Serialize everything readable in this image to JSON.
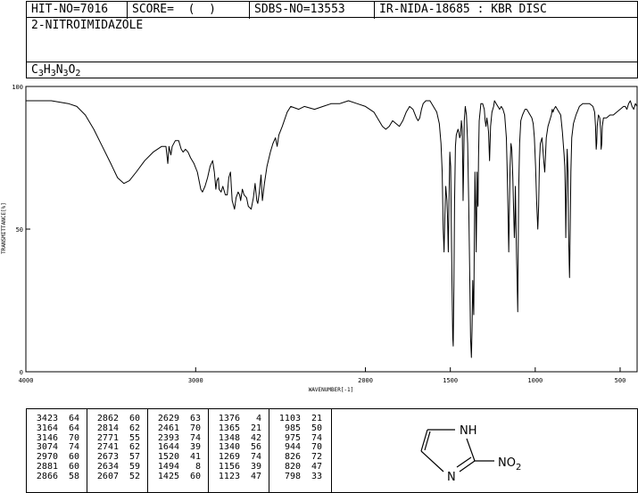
{
  "header": {
    "hit_no": "HIT-NO=7016",
    "score": "SCORE=  (  )",
    "sdbs_no": "SDBS-NO=13553",
    "ir_info": "IR-NIDA-18685 : KBR DISC"
  },
  "compound": {
    "name": "2-NITROIMIDAZOLE",
    "formula_parts": [
      {
        "t": "C",
        "sub": false
      },
      {
        "t": "3",
        "sub": true
      },
      {
        "t": "H",
        "sub": false
      },
      {
        "t": "3",
        "sub": true
      },
      {
        "t": "N",
        "sub": false
      },
      {
        "t": "3",
        "sub": true
      },
      {
        "t": "O",
        "sub": false
      },
      {
        "t": "2",
        "sub": true
      }
    ]
  },
  "chart_data": {
    "type": "line",
    "title": "",
    "xlabel": "WAVENUMBER[-1]",
    "ylabel": "TRANSMITTANCE[%]",
    "xlim": [
      4000,
      400
    ],
    "ylim": [
      0,
      100
    ],
    "x_ticks": [
      4000,
      3000,
      2000,
      1500,
      1000,
      500
    ],
    "y_ticks": [
      0,
      50,
      100
    ],
    "grid": false,
    "series": [
      {
        "points": [
          [
            4000,
            95
          ],
          [
            3850,
            95
          ],
          [
            3750,
            94
          ],
          [
            3700,
            93
          ],
          [
            3650,
            90
          ],
          [
            3600,
            85
          ],
          [
            3550,
            79
          ],
          [
            3500,
            73
          ],
          [
            3460,
            68
          ],
          [
            3423,
            66
          ],
          [
            3390,
            67
          ],
          [
            3350,
            70
          ],
          [
            3300,
            74
          ],
          [
            3250,
            77
          ],
          [
            3200,
            79
          ],
          [
            3175,
            79
          ],
          [
            3164,
            73
          ],
          [
            3157,
            79
          ],
          [
            3146,
            76
          ],
          [
            3138,
            79
          ],
          [
            3120,
            81
          ],
          [
            3100,
            81
          ],
          [
            3085,
            78
          ],
          [
            3074,
            77
          ],
          [
            3060,
            78
          ],
          [
            3045,
            77
          ],
          [
            3030,
            75
          ],
          [
            3010,
            73
          ],
          [
            2990,
            70
          ],
          [
            2980,
            67
          ],
          [
            2970,
            64
          ],
          [
            2960,
            63
          ],
          [
            2945,
            65
          ],
          [
            2930,
            68
          ],
          [
            2915,
            72
          ],
          [
            2900,
            74
          ],
          [
            2890,
            70
          ],
          [
            2881,
            64
          ],
          [
            2875,
            67
          ],
          [
            2866,
            68
          ],
          [
            2862,
            64
          ],
          [
            2850,
            63
          ],
          [
            2840,
            65
          ],
          [
            2825,
            62
          ],
          [
            2814,
            62
          ],
          [
            2805,
            68
          ],
          [
            2795,
            70
          ],
          [
            2785,
            60
          ],
          [
            2771,
            57
          ],
          [
            2762,
            61
          ],
          [
            2750,
            63
          ],
          [
            2741,
            62
          ],
          [
            2735,
            60
          ],
          [
            2725,
            64
          ],
          [
            2715,
            62
          ],
          [
            2700,
            61
          ],
          [
            2690,
            58
          ],
          [
            2673,
            57
          ],
          [
            2660,
            61
          ],
          [
            2650,
            66
          ],
          [
            2640,
            60
          ],
          [
            2634,
            59
          ],
          [
            2625,
            63
          ],
          [
            2615,
            69
          ],
          [
            2607,
            60
          ],
          [
            2595,
            66
          ],
          [
            2580,
            72
          ],
          [
            2560,
            77
          ],
          [
            2545,
            80
          ],
          [
            2530,
            82
          ],
          [
            2520,
            79
          ],
          [
            2510,
            83
          ],
          [
            2490,
            86
          ],
          [
            2461,
            91
          ],
          [
            2440,
            93
          ],
          [
            2393,
            92
          ],
          [
            2360,
            93
          ],
          [
            2300,
            92
          ],
          [
            2250,
            93
          ],
          [
            2200,
            94
          ],
          [
            2150,
            94
          ],
          [
            2100,
            95
          ],
          [
            2050,
            94
          ],
          [
            2000,
            93
          ],
          [
            1950,
            91
          ],
          [
            1920,
            88
          ],
          [
            1900,
            86
          ],
          [
            1880,
            85
          ],
          [
            1860,
            86
          ],
          [
            1840,
            88
          ],
          [
            1820,
            87
          ],
          [
            1800,
            86
          ],
          [
            1780,
            88
          ],
          [
            1760,
            91
          ],
          [
            1740,
            93
          ],
          [
            1720,
            92
          ],
          [
            1700,
            89
          ],
          [
            1690,
            88
          ],
          [
            1680,
            89
          ],
          [
            1670,
            92
          ],
          [
            1660,
            94
          ],
          [
            1644,
            95
          ],
          [
            1620,
            95
          ],
          [
            1600,
            93
          ],
          [
            1580,
            91
          ],
          [
            1565,
            87
          ],
          [
            1555,
            80
          ],
          [
            1548,
            70
          ],
          [
            1542,
            50
          ],
          [
            1537,
            42
          ],
          [
            1532,
            55
          ],
          [
            1527,
            65
          ],
          [
            1520,
            60
          ],
          [
            1517,
            55
          ],
          [
            1512,
            42
          ],
          [
            1508,
            60
          ],
          [
            1503,
            77
          ],
          [
            1498,
            72
          ],
          [
            1494,
            50
          ],
          [
            1490,
            30
          ],
          [
            1486,
            12
          ],
          [
            1483,
            9
          ],
          [
            1479,
            30
          ],
          [
            1475,
            60
          ],
          [
            1470,
            79
          ],
          [
            1465,
            83
          ],
          [
            1460,
            84
          ],
          [
            1455,
            85
          ],
          [
            1450,
            84
          ],
          [
            1445,
            82
          ],
          [
            1440,
            83
          ],
          [
            1435,
            88
          ],
          [
            1430,
            85
          ],
          [
            1427,
            72
          ],
          [
            1425,
            60
          ],
          [
            1422,
            70
          ],
          [
            1418,
            88
          ],
          [
            1412,
            93
          ],
          [
            1405,
            90
          ],
          [
            1398,
            80
          ],
          [
            1392,
            60
          ],
          [
            1386,
            35
          ],
          [
            1381,
            12
          ],
          [
            1376,
            5
          ],
          [
            1372,
            15
          ],
          [
            1368,
            32
          ],
          [
            1365,
            25
          ],
          [
            1362,
            20
          ],
          [
            1359,
            45
          ],
          [
            1355,
            70
          ],
          [
            1350,
            55
          ],
          [
            1348,
            42
          ],
          [
            1345,
            55
          ],
          [
            1343,
            70
          ],
          [
            1340,
            60
          ],
          [
            1337,
            58
          ],
          [
            1334,
            75
          ],
          [
            1330,
            88
          ],
          [
            1320,
            94
          ],
          [
            1310,
            94
          ],
          [
            1300,
            92
          ],
          [
            1295,
            88
          ],
          [
            1290,
            86
          ],
          [
            1285,
            89
          ],
          [
            1280,
            87
          ],
          [
            1275,
            84
          ],
          [
            1269,
            74
          ],
          [
            1263,
            86
          ],
          [
            1255,
            91
          ],
          [
            1245,
            93
          ],
          [
            1240,
            95
          ],
          [
            1230,
            94
          ],
          [
            1220,
            93
          ],
          [
            1210,
            92
          ],
          [
            1200,
            93
          ],
          [
            1190,
            92
          ],
          [
            1180,
            90
          ],
          [
            1170,
            82
          ],
          [
            1165,
            70
          ],
          [
            1160,
            55
          ],
          [
            1156,
            42
          ],
          [
            1152,
            58
          ],
          [
            1148,
            72
          ],
          [
            1143,
            80
          ],
          [
            1138,
            78
          ],
          [
            1135,
            73
          ],
          [
            1132,
            68
          ],
          [
            1128,
            58
          ],
          [
            1123,
            47
          ],
          [
            1120,
            52
          ],
          [
            1117,
            65
          ],
          [
            1113,
            50
          ],
          [
            1110,
            40
          ],
          [
            1106,
            30
          ],
          [
            1103,
            21
          ],
          [
            1100,
            45
          ],
          [
            1097,
            65
          ],
          [
            1092,
            80
          ],
          [
            1085,
            88
          ],
          [
            1075,
            90
          ],
          [
            1060,
            92
          ],
          [
            1050,
            92
          ],
          [
            1040,
            91
          ],
          [
            1030,
            90
          ],
          [
            1020,
            89
          ],
          [
            1012,
            87
          ],
          [
            1005,
            82
          ],
          [
            998,
            72
          ],
          [
            992,
            60
          ],
          [
            985,
            50
          ],
          [
            980,
            58
          ],
          [
            975,
            74
          ],
          [
            970,
            80
          ],
          [
            960,
            82
          ],
          [
            955,
            78
          ],
          [
            950,
            74
          ],
          [
            944,
            70
          ],
          [
            940,
            75
          ],
          [
            935,
            82
          ],
          [
            925,
            86
          ],
          [
            915,
            88
          ],
          [
            905,
            90
          ],
          [
            900,
            92
          ],
          [
            895,
            91
          ],
          [
            890,
            92
          ],
          [
            880,
            93
          ],
          [
            870,
            92
          ],
          [
            860,
            91
          ],
          [
            850,
            90
          ],
          [
            845,
            87
          ],
          [
            840,
            84
          ],
          [
            835,
            80
          ],
          [
            830,
            76
          ],
          [
            826,
            72
          ],
          [
            822,
            60
          ],
          [
            820,
            47
          ],
          [
            817,
            60
          ],
          [
            812,
            78
          ],
          [
            807,
            70
          ],
          [
            804,
            50
          ],
          [
            800,
            38
          ],
          [
            798,
            33
          ],
          [
            795,
            45
          ],
          [
            790,
            70
          ],
          [
            785,
            82
          ],
          [
            775,
            87
          ],
          [
            760,
            90
          ],
          [
            740,
            93
          ],
          [
            720,
            94
          ],
          [
            700,
            94
          ],
          [
            680,
            94
          ],
          [
            660,
            93
          ],
          [
            650,
            91
          ],
          [
            645,
            86
          ],
          [
            641,
            78
          ],
          [
            638,
            80
          ],
          [
            635,
            86
          ],
          [
            628,
            90
          ],
          [
            620,
            89
          ],
          [
            615,
            85
          ],
          [
            612,
            78
          ],
          [
            608,
            80
          ],
          [
            605,
            86
          ],
          [
            598,
            89
          ],
          [
            580,
            89
          ],
          [
            560,
            90
          ],
          [
            540,
            90
          ],
          [
            520,
            91
          ],
          [
            500,
            92
          ],
          [
            480,
            93
          ],
          [
            470,
            93
          ],
          [
            460,
            92
          ],
          [
            450,
            94
          ],
          [
            440,
            95
          ],
          [
            430,
            93
          ],
          [
            420,
            92
          ],
          [
            410,
            94
          ],
          [
            400,
            93
          ]
        ]
      }
    ]
  },
  "peak_table": {
    "columns": [
      [
        [
          "3423",
          "64"
        ],
        [
          "3164",
          "64"
        ],
        [
          "3146",
          "70"
        ],
        [
          "3074",
          "74"
        ],
        [
          "2970",
          "60"
        ],
        [
          "2881",
          "60"
        ],
        [
          "2866",
          "58"
        ]
      ],
      [
        [
          "2862",
          "60"
        ],
        [
          "2814",
          "62"
        ],
        [
          "2771",
          "55"
        ],
        [
          "2741",
          "62"
        ],
        [
          "2673",
          "57"
        ],
        [
          "2634",
          "59"
        ],
        [
          "2607",
          "52"
        ]
      ],
      [
        [
          "2629",
          "63"
        ],
        [
          "2461",
          "70"
        ],
        [
          "2393",
          "74"
        ],
        [
          "1644",
          "39"
        ],
        [
          "1520",
          "41"
        ],
        [
          "1494",
          "8"
        ],
        [
          "1425",
          "60"
        ]
      ],
      [
        [
          "1376",
          "4"
        ],
        [
          "1365",
          "21"
        ],
        [
          "1348",
          "42"
        ],
        [
          "1340",
          "56"
        ],
        [
          "1269",
          "74"
        ],
        [
          "1156",
          "39"
        ],
        [
          "1123",
          "47"
        ]
      ],
      [
        [
          "1103",
          "21"
        ],
        [
          "985",
          "50"
        ],
        [
          "975",
          "74"
        ],
        [
          "944",
          "70"
        ],
        [
          "826",
          "72"
        ],
        [
          "820",
          "47"
        ],
        [
          "798",
          "33"
        ]
      ]
    ]
  },
  "structure": {
    "nh_label": "NH",
    "n_label": "N",
    "no2_main": "NO",
    "no2_sub": "2"
  }
}
